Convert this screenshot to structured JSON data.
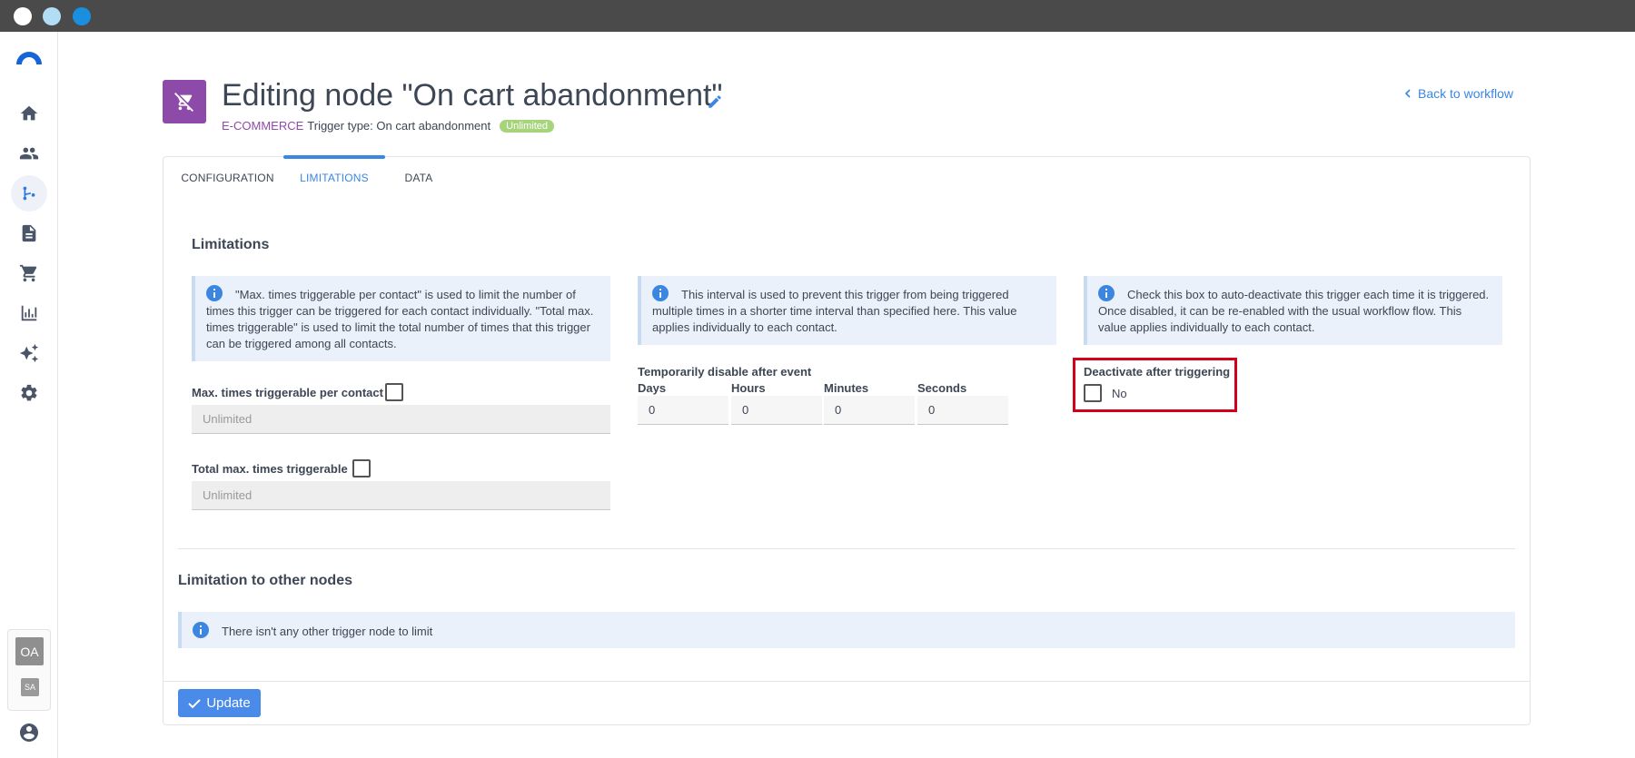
{
  "header": {
    "title": "Editing node \"On cart abandonment\"",
    "category": "E-COMMERCE",
    "trigger_type": "Trigger type: On cart abandonment",
    "badge": "Unlimited",
    "back_link": "Back to workflow"
  },
  "sidebar": {
    "items": [
      {
        "icon": "home-icon"
      },
      {
        "icon": "contacts-icon"
      },
      {
        "icon": "workflow-icon",
        "active": true
      },
      {
        "icon": "document-icon"
      },
      {
        "icon": "cart-icon"
      },
      {
        "icon": "chart-icon"
      },
      {
        "icon": "sparkles-icon"
      },
      {
        "icon": "gear-icon"
      }
    ],
    "avatar_primary": "OA",
    "avatar_secondary": "SA"
  },
  "tabs": [
    {
      "label": "CONFIGURATION"
    },
    {
      "label": "LIMITATIONS",
      "active": true
    },
    {
      "label": "DATA"
    }
  ],
  "limitations": {
    "title": "Limitations",
    "info1": "\"Max. times triggerable per contact\" is used to limit the number of times this trigger can be triggered for each contact individually. \"Total max. times triggerable\" is used to limit the total number of times that this trigger can be triggered among all contacts.",
    "info2": "This interval is used to prevent this trigger from being triggered multiple times in a shorter time interval than specified here. This value applies individually to each contact.",
    "info3": "Check this box to auto-deactivate this trigger each time it is triggered. Once disabled, it can be re-enabled with the usual workflow flow. This value applies individually to each contact.",
    "max_per_contact_label": "Max. times triggerable per contact",
    "max_per_contact_placeholder": "Unlimited",
    "total_max_label": "Total max. times triggerable",
    "total_max_placeholder": "Unlimited",
    "disable_label": "Temporarily disable after event",
    "days_label": "Days",
    "hours_label": "Hours",
    "minutes_label": "Minutes",
    "seconds_label": "Seconds",
    "days_value": "0",
    "hours_value": "0",
    "minutes_value": "0",
    "seconds_value": "0",
    "deactivate_label": "Deactivate after triggering",
    "deactivate_value": "No"
  },
  "other_nodes": {
    "title": "Limitation to other nodes",
    "info": "There isn't any other trigger node to limit"
  },
  "footer": {
    "update_label": "Update"
  },
  "colors": {
    "accent": "#3a86e0",
    "category": "#8e4aa8",
    "badge": "#a6d47a",
    "highlight": "#d0021b"
  }
}
